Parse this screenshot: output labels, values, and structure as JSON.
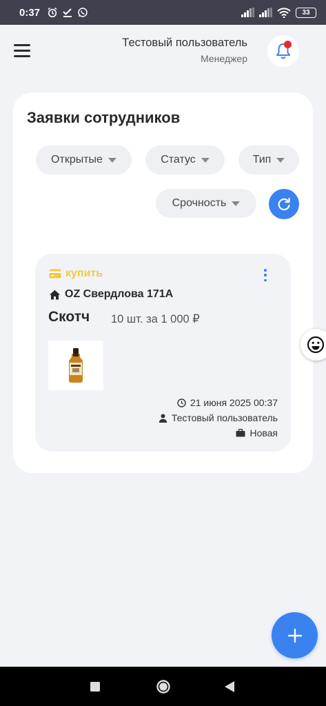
{
  "status_bar": {
    "time": "0:37",
    "battery": "33",
    "notification_icons": [
      "alarm-icon",
      "check-download-icon",
      "whatsapp-icon"
    ],
    "system_icons": [
      "signal-icon",
      "signal-icon",
      "wifi-icon",
      "battery-icon"
    ]
  },
  "header": {
    "user_name": "Тестовый пользователь",
    "user_role": "Менеджер"
  },
  "page": {
    "title": "Заявки сотрудников"
  },
  "filters": [
    {
      "label": "Открытые"
    },
    {
      "label": "Статус"
    },
    {
      "label": "Тип"
    },
    {
      "label": "Срочность"
    }
  ],
  "request": {
    "type_label": "купить",
    "store": "OZ Свердлова 171А",
    "item": "Скотч",
    "quantity_price": "10 шт. за 1 000 ₽",
    "datetime": "21 июня 2025 00:37",
    "author": "Тестовый пользователь",
    "status": "Новая"
  },
  "colors": {
    "accent": "#3a82f0",
    "type_color": "#f3c93f",
    "notification_dot": "#e52b2b",
    "status_bar": "#3f414f",
    "background": "#f2f3f7"
  }
}
